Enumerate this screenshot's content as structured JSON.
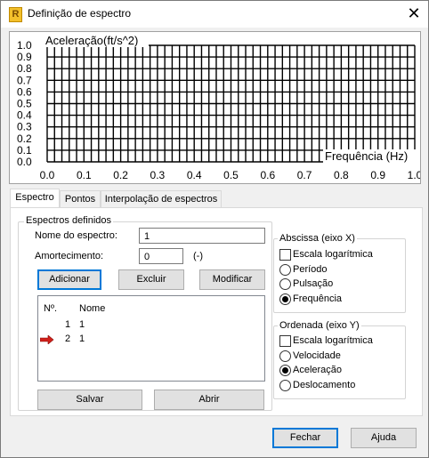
{
  "window": {
    "title": "Definição de espectro",
    "close_glyph": "✕",
    "app_icon_letter": "R"
  },
  "chart": {
    "y_axis_label": "Aceleração(ft/s^2)",
    "x_axis_label": "Frequência (Hz)",
    "y_ticks": [
      "0.0",
      "0.1",
      "0.2",
      "0.3",
      "0.4",
      "0.5",
      "0.6",
      "0.7",
      "0.8",
      "0.9",
      "1.0"
    ],
    "x_ticks": [
      "0.0",
      "0.1",
      "0.2",
      "0.3",
      "0.4",
      "0.5",
      "0.6",
      "0.7",
      "0.8",
      "0.9",
      "1.0"
    ]
  },
  "chart_data": {
    "type": "line",
    "xlabel": "Frequência (Hz)",
    "ylabel": "Aceleração(ft/s^2)",
    "xlim": [
      0,
      1.0
    ],
    "ylim": [
      0,
      1.0
    ],
    "x_ticks": [
      0.0,
      0.1,
      0.2,
      0.3,
      0.4,
      0.5,
      0.6,
      0.7,
      0.8,
      0.9,
      1.0
    ],
    "y_ticks": [
      0.0,
      0.1,
      0.2,
      0.3,
      0.4,
      0.5,
      0.6,
      0.7,
      0.8,
      0.9,
      1.0
    ],
    "grid": true,
    "series": []
  },
  "tabs": [
    {
      "label": "Espectro",
      "active": true
    },
    {
      "label": "Pontos",
      "active": false
    },
    {
      "label": "Interpolação de espectros",
      "active": false
    }
  ],
  "espectros": {
    "group_title": "Espectros definidos",
    "name_label": "Nome do espectro:",
    "name_value": "1",
    "damping_label": "Amortecimento:",
    "damping_value": "0",
    "damping_unit": "(-)",
    "buttons": {
      "add": "Adicionar",
      "delete": "Excluir",
      "modify": "Modificar"
    },
    "list": {
      "headers": {
        "number": "Nº.",
        "name": "Nome"
      },
      "rows": [
        {
          "number": "1",
          "name": "1",
          "current": false
        },
        {
          "number": "2",
          "name": "1",
          "current": true
        }
      ]
    },
    "save": "Salvar",
    "open": "Abrir"
  },
  "abscissa": {
    "title": "Abscissa (eixo X)",
    "log_label": "Escala logarítmica",
    "options": [
      {
        "label": "Período",
        "selected": false
      },
      {
        "label": "Pulsação",
        "selected": false
      },
      {
        "label": "Frequência",
        "selected": true
      }
    ]
  },
  "ordenada": {
    "title": "Ordenada (eixo Y)",
    "log_label": "Escala logarítmica",
    "options": [
      {
        "label": "Velocidade",
        "selected": false
      },
      {
        "label": "Aceleração",
        "selected": true
      },
      {
        "label": "Deslocamento",
        "selected": false
      }
    ]
  },
  "footer": {
    "close": "Fechar",
    "help": "Ajuda"
  }
}
